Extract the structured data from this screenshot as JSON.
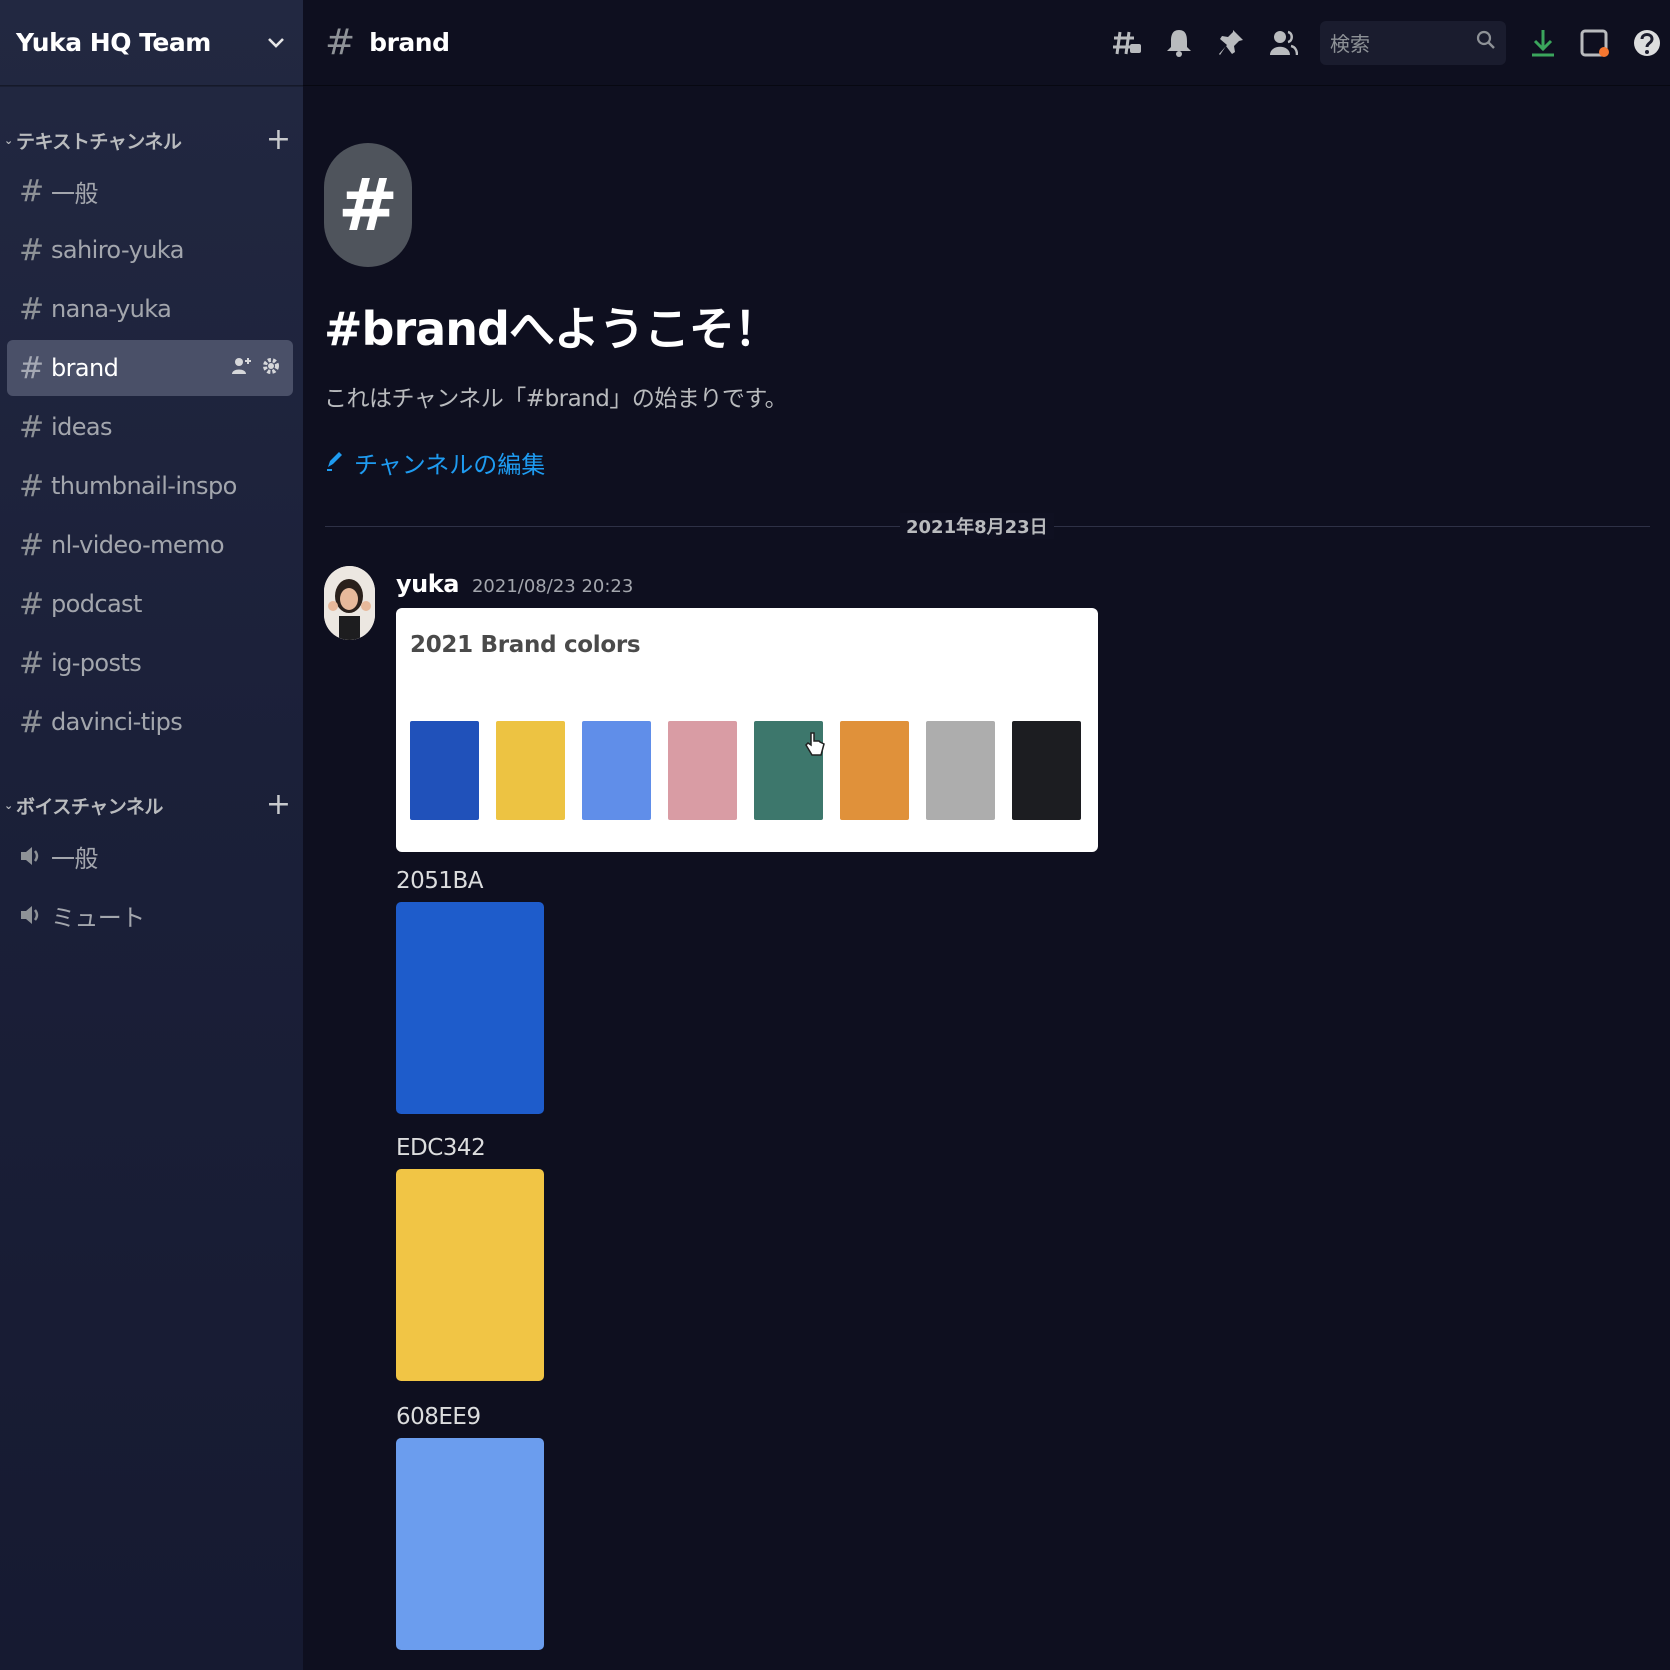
{
  "server": {
    "name": "Yuka HQ Team"
  },
  "sidebar": {
    "text_category": "テキストチャンネル",
    "voice_category": "ボイスチャンネル",
    "text_channels": [
      {
        "label": "一般"
      },
      {
        "label": "sahiro-yuka"
      },
      {
        "label": "nana-yuka"
      },
      {
        "label": "brand",
        "active": true
      },
      {
        "label": "ideas"
      },
      {
        "label": "thumbnail-inspo"
      },
      {
        "label": "nl-video-memo"
      },
      {
        "label": "podcast"
      },
      {
        "label": "ig-posts"
      },
      {
        "label": "davinci-tips"
      }
    ],
    "voice_channels": [
      {
        "label": "一般"
      },
      {
        "label": "ミュート"
      }
    ]
  },
  "topbar": {
    "channel_name": "brand",
    "search_placeholder": "検索"
  },
  "welcome": {
    "title": "#brandへようこそ！",
    "subtitle": "これはチャンネル「#brand」の始まりです。",
    "edit_link": "チャンネルの編集"
  },
  "divider": {
    "date": "2021年8月23日"
  },
  "message": {
    "author": "yuka",
    "timestamp": "2021/08/23 20:23",
    "card_title": "2021 Brand colors",
    "swatches": [
      "#2051BA",
      "#EDC342",
      "#608EE9",
      "#D99CA4",
      "#3D776C",
      "#E0913A",
      "#ADADAD",
      "#1C1D21"
    ],
    "colors": [
      {
        "label": "2051BA",
        "hex": "#1E5CCB"
      },
      {
        "label": "EDC342",
        "hex": "#F1C545"
      },
      {
        "label": "608EE9",
        "hex": "#6B9DEE"
      }
    ]
  },
  "colors": {
    "accent_link": "#1E9BF0",
    "notification_dot": "#F57731"
  }
}
